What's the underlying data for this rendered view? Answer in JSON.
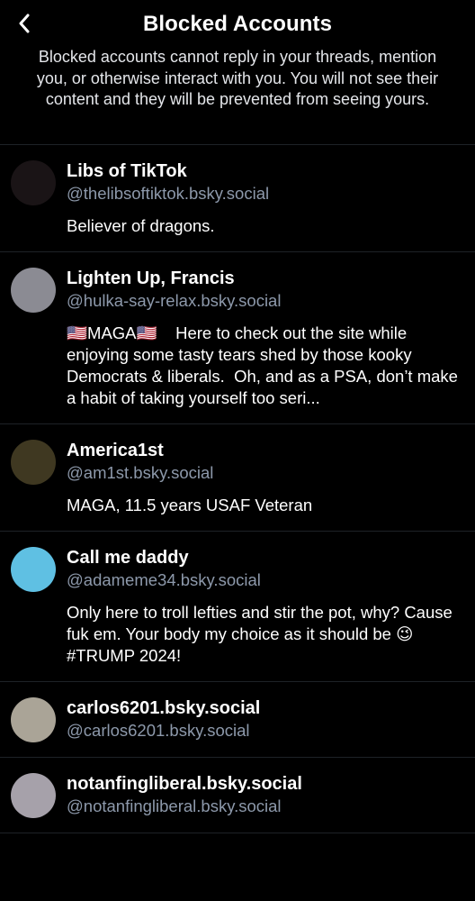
{
  "header": {
    "back_icon": "chevron-left-icon",
    "title": "Blocked Accounts"
  },
  "description": "Blocked accounts cannot reply in your threads, mention you, or otherwise interact with you. You will not see their content and they will be prevented from seeing yours.",
  "accounts": [
    {
      "name": "Libs of TikTok",
      "handle": "@thelibsoftiktok.bsky.social",
      "bio": "Believer of dragons.",
      "avatar_color": "#1a1416"
    },
    {
      "name": "Lighten Up, Francis",
      "handle": "@hulka-say-relax.bsky.social",
      "bio": "🇺🇸MAGA🇺🇸    Here to check out the site while enjoying some tasty tears shed by those kooky Democrats & liberals.  Oh, and as a PSA, don’t make a habit of taking yourself too seri...",
      "avatar_color": "#8b8b93"
    },
    {
      "name": "America1st",
      "handle": "@am1st.bsky.social",
      "bio": "MAGA, 11.5 years USAF Veteran",
      "avatar_color": "#3f3821"
    },
    {
      "name": "Call me daddy",
      "handle": "@adameme34.bsky.social",
      "bio": "Only here to troll lefties and stir the pot, why? Cause fuk em. Your body my choice as it should be 😉\n#TRUMP 2024!",
      "avatar_color": "#5fc0e3"
    },
    {
      "name": "carlos6201.bsky.social",
      "handle": "@carlos6201.bsky.social",
      "bio": "",
      "avatar_color": "#aaa497"
    },
    {
      "name": "notanfingliberal.bsky.social",
      "handle": "@notanfingliberal.bsky.social",
      "bio": "",
      "avatar_color": "#a6a1aa"
    }
  ]
}
